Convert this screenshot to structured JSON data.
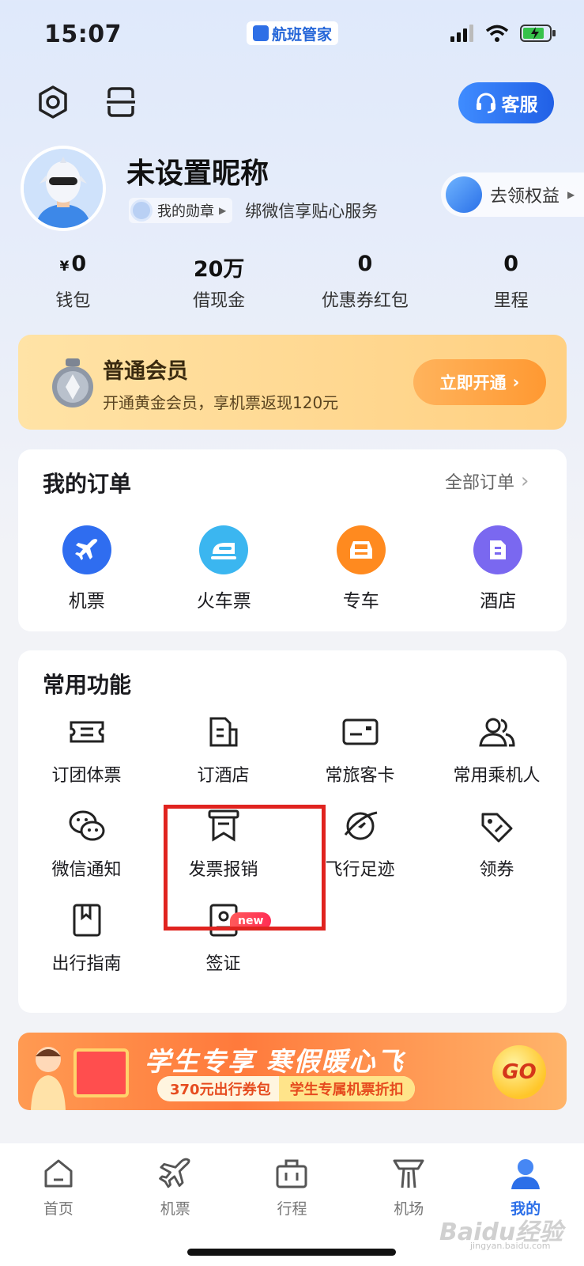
{
  "status_bar": {
    "time": "15:07",
    "app_name": "航班管家"
  },
  "header": {
    "service_label": "客服"
  },
  "profile": {
    "nickname": "未设置昵称",
    "medal_label": "我的勋章",
    "bind_text": "绑微信享贴心服务",
    "benefit_label": "去领权益"
  },
  "stats": [
    {
      "prefix": "¥",
      "value": "0",
      "label": "钱包"
    },
    {
      "prefix": "",
      "value": "20万",
      "label": "借现金"
    },
    {
      "prefix": "",
      "value": "0",
      "label": "优惠券红包"
    },
    {
      "prefix": "",
      "value": "0",
      "label": "里程"
    }
  ],
  "membership": {
    "title": "普通会员",
    "subtitle": "开通黄金会员，享机票返现120元",
    "button": "立即开通"
  },
  "orders": {
    "title": "我的订单",
    "all_label": "全部订单",
    "items": [
      {
        "label": "机票",
        "icon": "plane-icon",
        "color": "#2f6df0"
      },
      {
        "label": "火车票",
        "icon": "train-icon",
        "color": "#3bb6f0"
      },
      {
        "label": "专车",
        "icon": "car-icon",
        "color": "#ff8a1f"
      },
      {
        "label": "酒店",
        "icon": "hotel-icon",
        "color": "#7a68f0"
      }
    ]
  },
  "features": {
    "title": "常用功能",
    "items": [
      {
        "label": "订团体票",
        "icon": "group-ticket-icon"
      },
      {
        "label": "订酒店",
        "icon": "hotel-booking-icon"
      },
      {
        "label": "常旅客卡",
        "icon": "frequent-flyer-card-icon"
      },
      {
        "label": "常用乘机人",
        "icon": "passengers-icon"
      },
      {
        "label": "微信通知",
        "icon": "wechat-icon"
      },
      {
        "label": "发票报销",
        "icon": "invoice-icon"
      },
      {
        "label": "飞行足迹",
        "icon": "flight-footprint-icon"
      },
      {
        "label": "领券",
        "icon": "coupon-icon"
      },
      {
        "label": "出行指南",
        "icon": "travel-guide-icon"
      },
      {
        "label": "签证",
        "icon": "visa-icon"
      }
    ],
    "new_badge": "new"
  },
  "banner": {
    "title": "学生专享 寒假暖心飞",
    "tag_a": "370元出行券包",
    "tag_b": "学生专属机票折扣",
    "go": "GO"
  },
  "tabbar": {
    "items": [
      {
        "label": "首页",
        "icon": "home-icon",
        "active": false
      },
      {
        "label": "机票",
        "icon": "plane-tab-icon",
        "active": false
      },
      {
        "label": "行程",
        "icon": "itinerary-icon",
        "active": false
      },
      {
        "label": "机场",
        "icon": "airport-icon",
        "active": false
      },
      {
        "label": "我的",
        "icon": "profile-icon",
        "active": true
      }
    ],
    "active_color": "#2c6fe8"
  },
  "watermark": {
    "main": "Baidu经验",
    "sub": "jingyan.baidu.com"
  }
}
